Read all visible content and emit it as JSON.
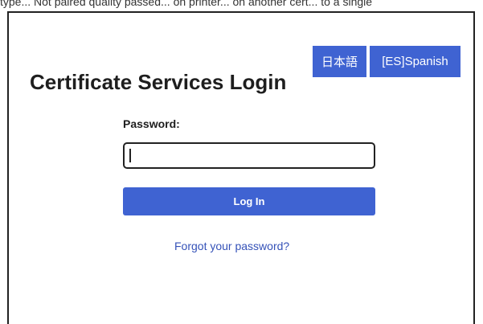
{
  "top_strip": {
    "text": "type... Not paired quality passed... on printer... on another cert... to a single"
  },
  "language_buttons": {
    "japanese_label": "日本語",
    "spanish_label": "[ES]Spanish"
  },
  "login": {
    "title": "Certificate Services Login",
    "password_label": "Password:",
    "password_value": "",
    "login_button_label": "Log In",
    "forgot_password_link": "Forgot your password?"
  },
  "colors": {
    "accent_blue": "#3f63d2",
    "link_blue": "#3552b8",
    "text_dark": "#1e1e1e",
    "border_dark": "#222222"
  }
}
